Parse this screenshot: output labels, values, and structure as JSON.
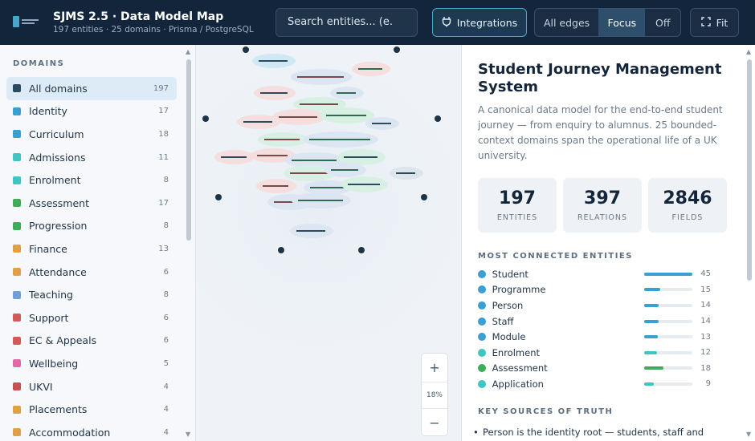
{
  "header": {
    "title": "SJMS 2.5 · Data Model Map",
    "subtitle": "197 entities · 25 domains · Prisma / PostgreSQL",
    "search_placeholder": "Search entities... (e.",
    "integrations_label": "Integrations",
    "edge_modes": [
      "All edges",
      "Focus",
      "Off"
    ],
    "edge_mode_selected": "Focus",
    "fit_label": "Fit"
  },
  "sidebar": {
    "heading": "DOMAINS",
    "items": [
      {
        "label": "All domains",
        "count": "197",
        "color": "#2c4a5f",
        "active": true
      },
      {
        "label": "Identity",
        "count": "17",
        "color": "#3b9fd1"
      },
      {
        "label": "Curriculum",
        "count": "18",
        "color": "#3b9fd1"
      },
      {
        "label": "Admissions",
        "count": "11",
        "color": "#3fc6c2"
      },
      {
        "label": "Enrolment",
        "count": "8",
        "color": "#3fc6c2"
      },
      {
        "label": "Assessment",
        "count": "17",
        "color": "#3ead5a"
      },
      {
        "label": "Progression",
        "count": "8",
        "color": "#3ead5a"
      },
      {
        "label": "Finance",
        "count": "13",
        "color": "#e0a04a"
      },
      {
        "label": "Attendance",
        "count": "6",
        "color": "#e0a04a"
      },
      {
        "label": "Teaching",
        "count": "8",
        "color": "#6f9fd6"
      },
      {
        "label": "Support",
        "count": "6",
        "color": "#d45a5a"
      },
      {
        "label": "EC & Appeals",
        "count": "6",
        "color": "#d45a5a"
      },
      {
        "label": "Wellbeing",
        "count": "5",
        "color": "#e06aa6"
      },
      {
        "label": "UKVI",
        "count": "4",
        "color": "#c94f4f"
      },
      {
        "label": "Placements",
        "count": "4",
        "color": "#e0a04a"
      },
      {
        "label": "Accommodation",
        "count": "4",
        "color": "#e0a04a"
      }
    ]
  },
  "canvas": {
    "zoom_in": "+",
    "zoom_level": "18%",
    "zoom_out": "−"
  },
  "panel": {
    "title": "Student Journey Management System",
    "description": "A canonical data model for the end-to-end student journey — from enquiry to alumnus. 25 bounded-context domains span the operational life of a UK university.",
    "stats": [
      {
        "value": "197",
        "label": "ENTITIES"
      },
      {
        "value": "397",
        "label": "RELATIONS"
      },
      {
        "value": "2846",
        "label": "FIELDS"
      }
    ],
    "connected_heading": "MOST CONNECTED ENTITIES",
    "connected": [
      {
        "name": "Student",
        "value": 45,
        "color": "#3b9fd1"
      },
      {
        "name": "Programme",
        "value": 15,
        "color": "#3b9fd1"
      },
      {
        "name": "Person",
        "value": 14,
        "color": "#3b9fd1"
      },
      {
        "name": "Staff",
        "value": 14,
        "color": "#3b9fd1"
      },
      {
        "name": "Module",
        "value": 13,
        "color": "#3b9fd1"
      },
      {
        "name": "Enrolment",
        "value": 12,
        "color": "#3fc6c2"
      },
      {
        "name": "Assessment",
        "value": 18,
        "color": "#3ead5a"
      },
      {
        "name": "Application",
        "value": 9,
        "color": "#3fc6c2"
      }
    ],
    "truth_heading": "KEY SOURCES OF TRUTH",
    "truth_first": "Person is the identity root — students, staff and"
  }
}
